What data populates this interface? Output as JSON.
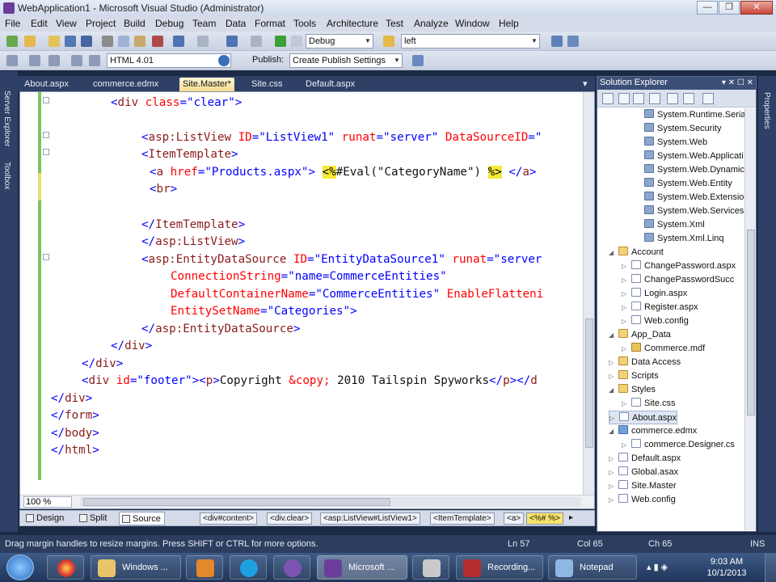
{
  "window": {
    "title": "WebApplication1 - Microsoft Visual Studio (Administrator)"
  },
  "menu": [
    "File",
    "Edit",
    "View",
    "Project",
    "Build",
    "Debug",
    "Team",
    "Data",
    "Format",
    "Tools",
    "Architecture",
    "Test",
    "Analyze",
    "Window",
    "Help"
  ],
  "toolbar": {
    "config_value": "Debug",
    "find_value": "left",
    "doctype_value": "HTML 4.01",
    "publish_label": "Publish:",
    "publish_value": "Create Publish Settings"
  },
  "side_tabs": {
    "server_explorer": "Server Explorer",
    "toolbox": "Toolbox",
    "properties": "Properties"
  },
  "doc_tabs": [
    "About.aspx",
    "commerce.edmx",
    "Site.Master*",
    "Site.css",
    "Default.aspx"
  ],
  "active_tab": "Site.Master*",
  "code": {
    "l1": "<div class=\"clear\">",
    "l2": "<asp:ListView ID=\"ListView1\" runat=\"server\" DataSourceID=\"",
    "l3": "<ItemTemplate>",
    "l4": "<a href=\"Products.aspx\"> <%#Eval(\"CategoryName\") %> </a>",
    "l5": "<br>",
    "l6": "</ItemTemplate>",
    "l7": "</asp:ListView>",
    "l8": "<asp:EntityDataSource ID=\"EntityDataSource1\" runat=\"server",
    "l9": "ConnectionString=\"name=CommerceEntities\"",
    "l10": "DefaultContainerName=\"CommerceEntities\" EnableFlatteni",
    "l11": "EntitySetName=\"Categories\">",
    "l12": "</asp:EntityDataSource>",
    "l13": "</div>",
    "l14": "</div>",
    "l15": "<div id=\"footer\"><p>Copyright &copy; 2010 Tailspin Spyworks</p></d",
    "l16": "</div>",
    "l17": "</form>",
    "l18": "</body>",
    "l19": "</html>"
  },
  "zoom": "100 %",
  "views": {
    "design": "Design",
    "split": "Split",
    "source": "Source"
  },
  "breadcrumbs": [
    "<div#content>",
    "<div.clear>",
    "<asp:ListView#ListView1>",
    "<ItemTemplate>",
    "<a>",
    "<%# %>"
  ],
  "solution_explorer": {
    "title": "Solution Explorer",
    "controls": "▾ ✕ ☐ ✕",
    "items": [
      {
        "label": "System.Runtime.Serial",
        "kind": "ref",
        "depth": 2
      },
      {
        "label": "System.Security",
        "kind": "ref",
        "depth": 2
      },
      {
        "label": "System.Web",
        "kind": "ref",
        "depth": 2
      },
      {
        "label": "System.Web.Applicati",
        "kind": "ref",
        "depth": 2
      },
      {
        "label": "System.Web.Dynamicl",
        "kind": "ref",
        "depth": 2
      },
      {
        "label": "System.Web.Entity",
        "kind": "ref",
        "depth": 2
      },
      {
        "label": "System.Web.Extension",
        "kind": "ref",
        "depth": 2
      },
      {
        "label": "System.Web.Services",
        "kind": "ref",
        "depth": 2
      },
      {
        "label": "System.Xml",
        "kind": "ref",
        "depth": 2
      },
      {
        "label": "System.Xml.Linq",
        "kind": "ref",
        "depth": 2
      },
      {
        "label": "Account",
        "kind": "folder",
        "depth": 0,
        "expanded": true
      },
      {
        "label": "ChangePassword.aspx",
        "kind": "file",
        "depth": 1
      },
      {
        "label": "ChangePasswordSucc",
        "kind": "file",
        "depth": 1
      },
      {
        "label": "Login.aspx",
        "kind": "file",
        "depth": 1
      },
      {
        "label": "Register.aspx",
        "kind": "file",
        "depth": 1
      },
      {
        "label": "Web.config",
        "kind": "file",
        "depth": 1
      },
      {
        "label": "App_Data",
        "kind": "folder",
        "depth": 0,
        "expanded": true
      },
      {
        "label": "Commerce.mdf",
        "kind": "db",
        "depth": 1
      },
      {
        "label": "Data Access",
        "kind": "folder",
        "depth": 0
      },
      {
        "label": "Scripts",
        "kind": "folder",
        "depth": 0
      },
      {
        "label": "Styles",
        "kind": "folder",
        "depth": 0,
        "expanded": true
      },
      {
        "label": "Site.css",
        "kind": "file",
        "depth": 1
      },
      {
        "label": "About.aspx",
        "kind": "file",
        "depth": 0,
        "selected": true
      },
      {
        "label": "commerce.edmx",
        "kind": "edmx",
        "depth": 0,
        "expanded": true
      },
      {
        "label": "commerce.Designer.cs",
        "kind": "file",
        "depth": 1
      },
      {
        "label": "Default.aspx",
        "kind": "file",
        "depth": 0
      },
      {
        "label": "Global.asax",
        "kind": "file",
        "depth": 0
      },
      {
        "label": "Site.Master",
        "kind": "file",
        "depth": 0
      },
      {
        "label": "Web.config",
        "kind": "file",
        "depth": 0
      }
    ]
  },
  "status": {
    "message": "Drag margin handles to resize margins. Press SHIFT or CTRL for more options.",
    "ln": "Ln 57",
    "col": "Col 65",
    "ch": "Ch 65",
    "mode": "INS"
  },
  "taskbar": {
    "items": [
      "Windows ...",
      "",
      "",
      "",
      "Microsoft ...",
      "",
      "Recording...",
      "Notepad"
    ],
    "time": "9:03 AM",
    "date": "10/1/2013"
  }
}
